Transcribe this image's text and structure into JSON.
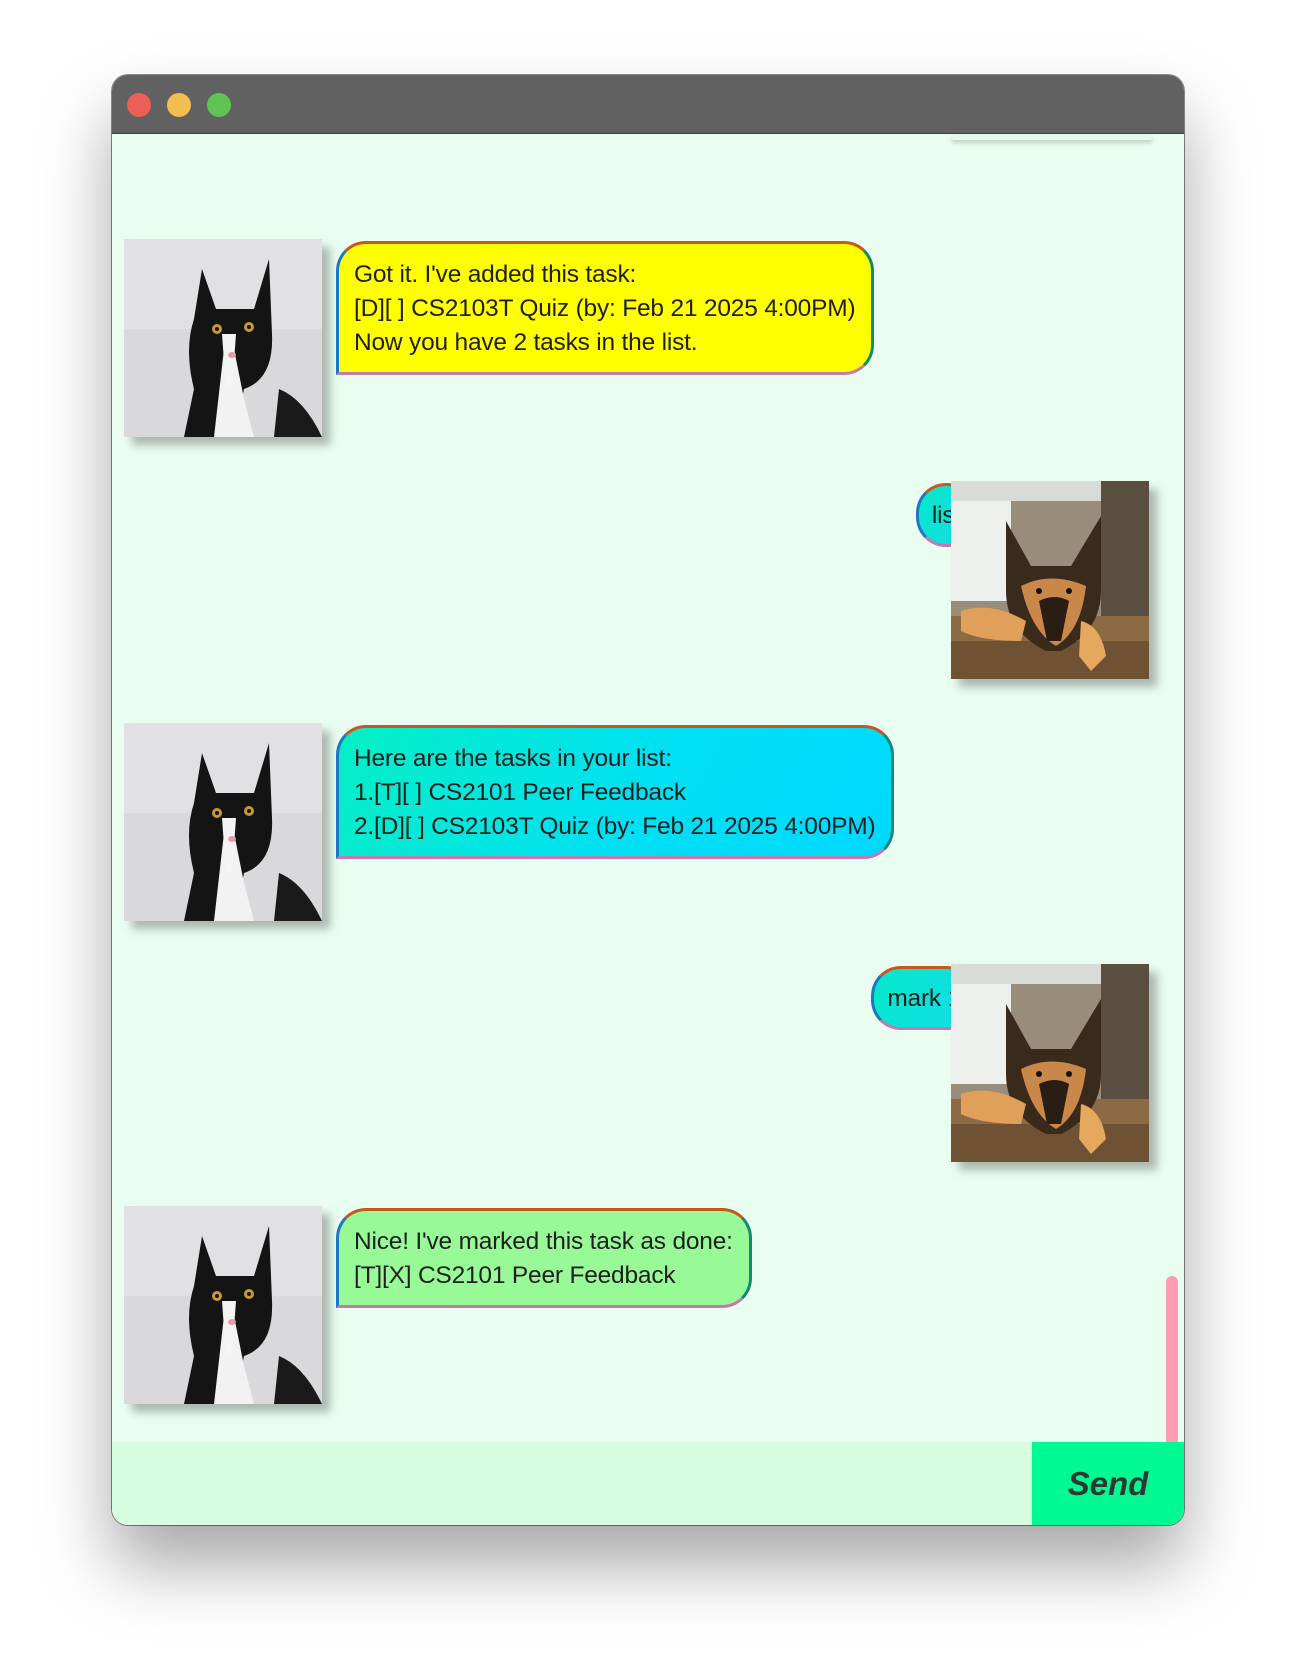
{
  "window": {
    "controls": [
      "close",
      "minimize",
      "zoom"
    ]
  },
  "messages": [
    {
      "sender": "bot",
      "avatar": "cat-avatar",
      "style": "yellow",
      "text": "Got it. I've added this task:\n[D][ ] CS2103T Quiz (by: Feb 21 2025 4:00PM)\nNow you have 2 tasks in the list."
    },
    {
      "sender": "user",
      "avatar": "dog-avatar",
      "text": "list"
    },
    {
      "sender": "bot",
      "avatar": "cat-avatar",
      "style": "cyan",
      "text": "Here are the tasks in your list:\n1.[T][ ] CS2101 Peer Feedback\n2.[D][ ] CS2103T Quiz (by: Feb 21 2025 4:00PM)"
    },
    {
      "sender": "user",
      "avatar": "dog-avatar",
      "text": "mark 1"
    },
    {
      "sender": "bot",
      "avatar": "cat-avatar",
      "style": "green",
      "text": "Nice! I've marked this task as done:\n[T][X] CS2101 Peer Feedback"
    }
  ],
  "input": {
    "value": "",
    "placeholder": ""
  },
  "send_button": {
    "label": "Send"
  },
  "colors": {
    "background": "#e9fdf0",
    "input_background": "#d6fddf",
    "send_button": "#00f993",
    "scrollbar": "#fc9bb2",
    "bubble_yellow": "#ffff00",
    "bubble_green": "#98fa96",
    "bubble_cyan": "#00d8ff"
  }
}
